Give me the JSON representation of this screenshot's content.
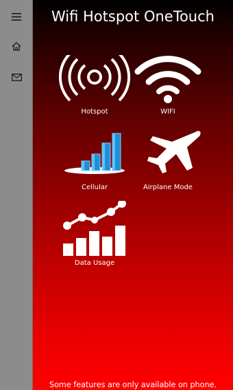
{
  "app": {
    "title": "Wifi Hotspot OneTouch",
    "footer_note": "Some features are only available on phone."
  },
  "sidebar": {
    "items": [
      {
        "icon": "hamburger-menu-icon"
      },
      {
        "icon": "home-icon"
      },
      {
        "icon": "mail-icon"
      }
    ]
  },
  "tiles": [
    {
      "label": "Hotspot",
      "icon": "hotspot-broadcast-icon"
    },
    {
      "label": "WIFI",
      "icon": "wifi-icon"
    },
    {
      "label": "Cellular",
      "icon": "cellular-bars-icon"
    },
    {
      "label": "Airplane Mode",
      "icon": "airplane-icon"
    },
    {
      "label": "Data Usage",
      "icon": "data-usage-chart-icon"
    }
  ],
  "colors": {
    "sidebar": "#8c8c8c",
    "gradient_top": "#000000",
    "gradient_bottom": "#ff0000",
    "cellular_blue": "#1e90d8"
  }
}
